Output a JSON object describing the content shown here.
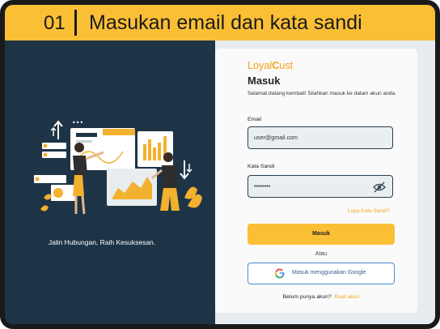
{
  "banner": {
    "step": "01",
    "title": "Masukan email dan kata sandi"
  },
  "left": {
    "tagline": "Jalin Hubungan, Raih Kesuksesan."
  },
  "form": {
    "logo_left": "Loyal",
    "logo_c": "C",
    "logo_right": "ust",
    "title": "Masuk",
    "intro": "Selamat datang kembali! Silahkan masuk ke dalam akun anda.",
    "email_label": "Email",
    "email_value": "user@gmail.com",
    "password_label": "Kata Sandi",
    "password_value": "••••••••",
    "forgot": "Lupa Kata Sandi?",
    "submit": "Masuk",
    "or": "Atau",
    "google": "Masuk menggunakan Google",
    "signup_text": "Belum punya akun?",
    "signup_link": "Buat akun"
  },
  "colors": {
    "accent": "#fbbf36",
    "panel_dark": "#1d3446",
    "link": "#f2a61c"
  },
  "icons": {
    "password_toggle": "eye-off-icon",
    "google": "google-icon"
  }
}
